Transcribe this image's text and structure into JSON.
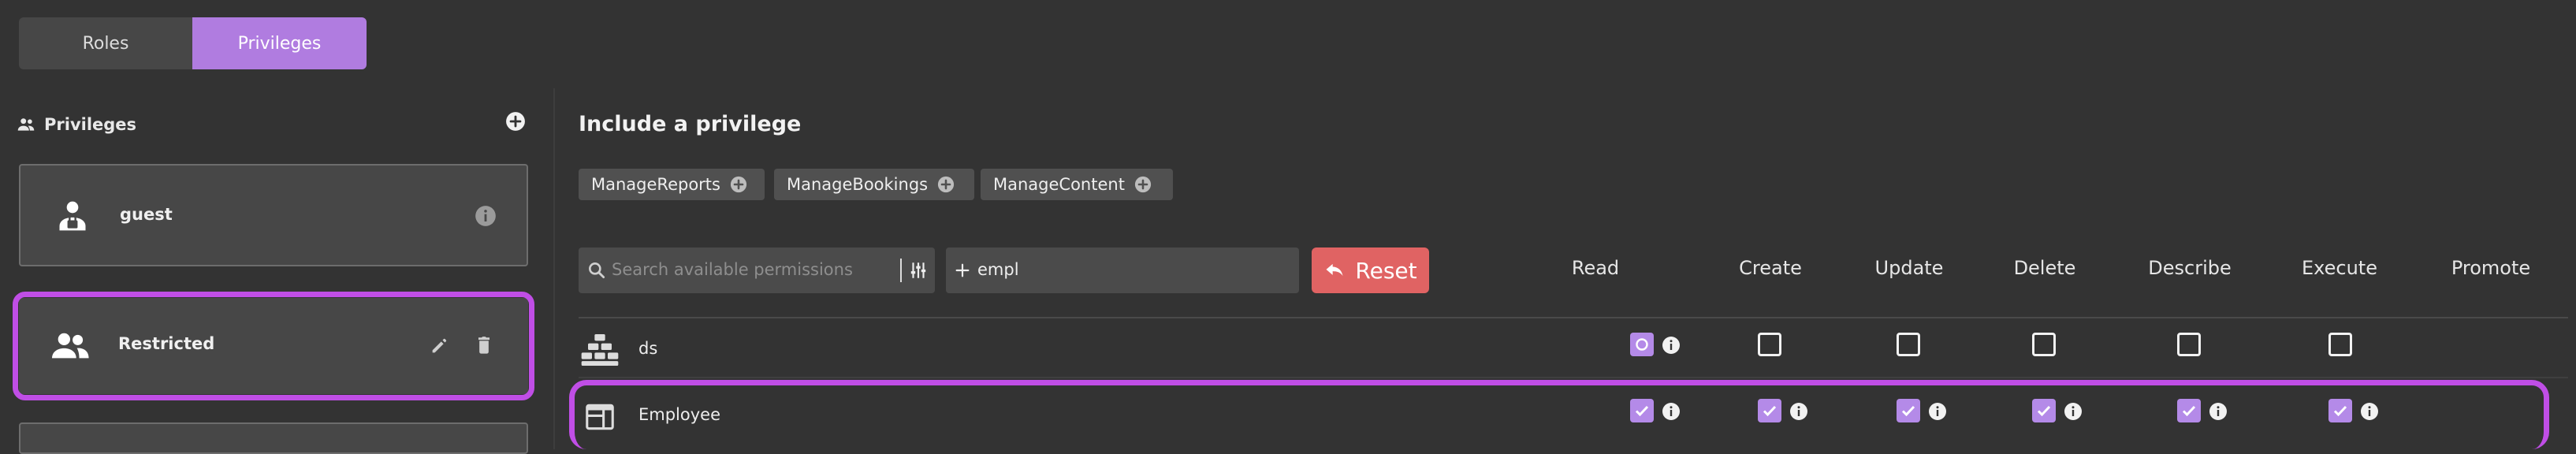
{
  "tabs": {
    "roles": "Roles",
    "privileges": "Privileges"
  },
  "sidebar": {
    "title": "Privileges",
    "items": [
      {
        "name": "guest"
      },
      {
        "name": "Restricted"
      }
    ]
  },
  "main": {
    "title": "Include a privilege",
    "chips": [
      "ManageReports",
      "ManageBookings",
      "ManageContent"
    ],
    "search_placeholder": "Search available permissions",
    "filter_value": "empl",
    "reset_label": "Reset",
    "columns": [
      "Read",
      "Create",
      "Update",
      "Delete",
      "Describe",
      "Execute",
      "Promote"
    ],
    "rows": [
      {
        "label": "ds",
        "states": [
          "partial",
          "empty",
          "empty",
          "empty",
          "empty",
          "empty"
        ]
      },
      {
        "label": "Employee",
        "states": [
          "checked",
          "checked",
          "checked",
          "checked",
          "checked",
          "checked"
        ]
      }
    ]
  },
  "colors": {
    "accent": "#b07ce0",
    "selection": "#c04ee6",
    "reset": "#e06363",
    "background": "#333333"
  },
  "icons": [
    "people-icon",
    "add-circle-icon",
    "locked-user-icon",
    "info-icon",
    "group-icon",
    "edit-icon",
    "trash-icon",
    "plus-circle-icon",
    "search-icon",
    "tune-icon",
    "undo-icon",
    "database-icon",
    "table-icon",
    "checkbox-icon"
  ]
}
